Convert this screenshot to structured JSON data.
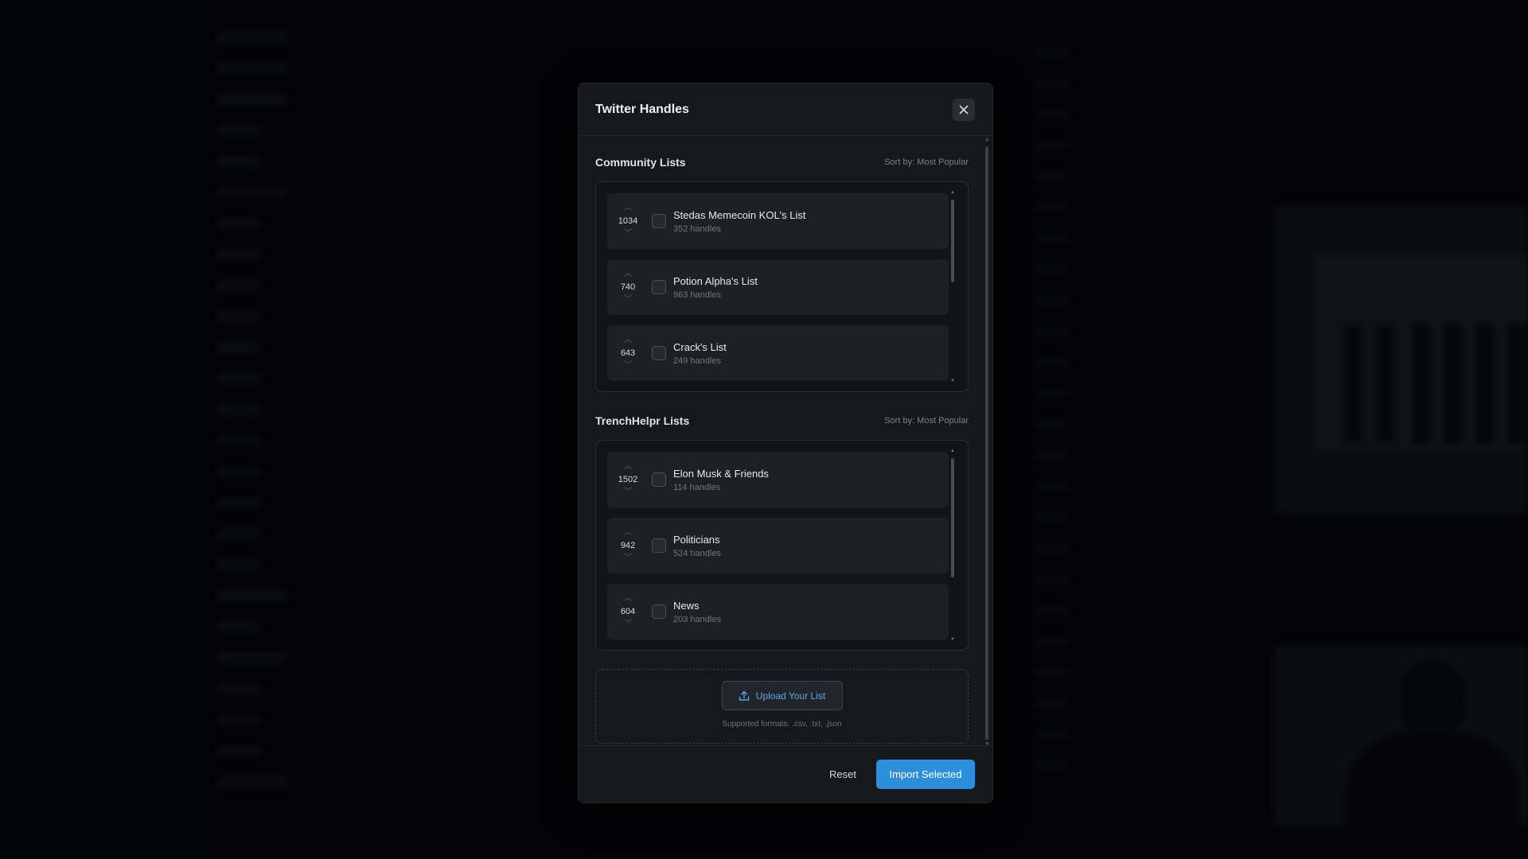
{
  "modal": {
    "title": "Twitter Handles",
    "close_icon": "close-icon"
  },
  "community": {
    "title": "Community Lists",
    "sort_label": "Sort by: Most Popular",
    "items": [
      {
        "votes": "1034",
        "name": "Stedas Memecoin KOL's List",
        "handles": "352 handles"
      },
      {
        "votes": "740",
        "name": "Potion Alpha's List",
        "handles": "963 handles"
      },
      {
        "votes": "643",
        "name": "Crack's List",
        "handles": "249 handles"
      }
    ]
  },
  "trenchhelpr": {
    "title": "TrenchHelpr Lists",
    "sort_label": "Sort by: Most Popular",
    "items": [
      {
        "votes": "1502",
        "name": "Elon Musk & Friends",
        "handles": "114 handles"
      },
      {
        "votes": "942",
        "name": "Politicians",
        "handles": "524 handles"
      },
      {
        "votes": "604",
        "name": "News",
        "handles": "203 handles"
      }
    ]
  },
  "upload": {
    "button_label": "Upload Your List",
    "icon": "upload-icon",
    "formats": "Supported formats: .csv, .txt, .json"
  },
  "footer": {
    "reset_label": "Reset",
    "import_label": "Import Selected"
  },
  "colors": {
    "accent": "#2d8fdb",
    "upload_text": "#5ba7e6"
  }
}
